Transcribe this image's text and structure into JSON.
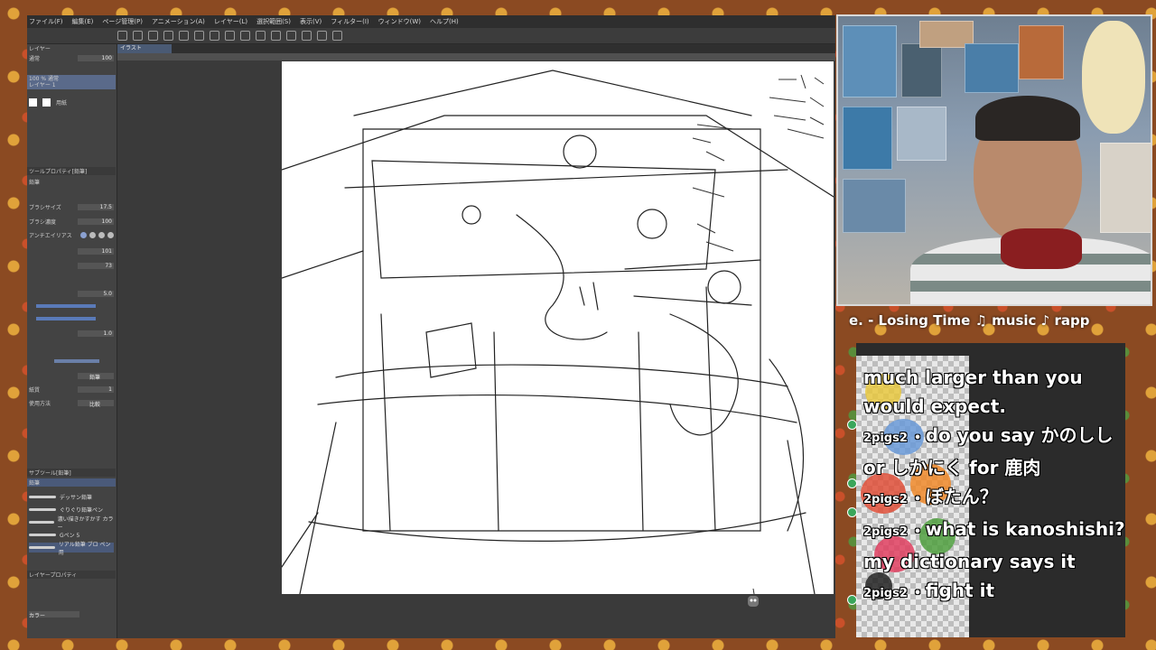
{
  "menu": {
    "items": [
      "ファイル(F)",
      "編集(E)",
      "ページ管理(P)",
      "アニメーション(A)",
      "レイヤー(L)",
      "選択範囲(S)",
      "表示(V)",
      "フィルター(I)",
      "ウィンドウ(W)",
      "ヘルプ(H)"
    ]
  },
  "document": {
    "tab_label": "イラスト"
  },
  "layers": {
    "blend_mode": "通常",
    "opacity": "100",
    "layer1_name": "100 % 通常",
    "layer1_sub": "レイヤー 1",
    "paper_name": "用紙"
  },
  "tool_property": {
    "header": "ツールプロパティ[鉛筆]",
    "sub_tool": "鉛筆",
    "size_label": "ブラシサイズ",
    "size_value": "17.5",
    "density_label": "ブラシ濃度",
    "density_value": "100",
    "aa_label": "アンチエイリアス",
    "value_101": "101",
    "value_73": "73",
    "value_50": "5.0",
    "value_10": "1.0",
    "value_1": "1",
    "pencil_label": "鉛筆",
    "compare_label": "比較",
    "paper_texture_label": "紙質",
    "usage_label": "使用方法"
  },
  "sub_tools": {
    "header": "サブツール[鉛筆]",
    "active_label": "鉛筆",
    "items": [
      "デッサン鉛筆",
      "ぐりぐり鉛筆ペン",
      "濃い描きかすかす カラー",
      "Gペン 5",
      "リアル鉛筆 ブロ ペン用"
    ]
  },
  "layer_property": {
    "header": "レイヤープロパティ",
    "color_label": "カラー"
  },
  "now_playing": {
    "text": "e. - Losing Time      ♫ music ♪ rapp"
  },
  "chat": {
    "messages": [
      {
        "user": "",
        "text": "much larger than you would expect."
      },
      {
        "user": "2pigs2",
        "text": "do you say かのしし or しかにく for 鹿肉"
      },
      {
        "user": "2pigs2",
        "text": "ぼたん？"
      },
      {
        "user": "2pigs2",
        "text": "what is kanoshishi? my dictionary says it"
      },
      {
        "user": "2pigs2",
        "text": "fight it"
      }
    ]
  },
  "colors": {
    "stream_bg": "#8b4a22",
    "app_bg": "#3a3a3a",
    "panel_bg": "#434343",
    "accent": "#5a7ab8",
    "chat_user_badge": "#3aa65a"
  }
}
